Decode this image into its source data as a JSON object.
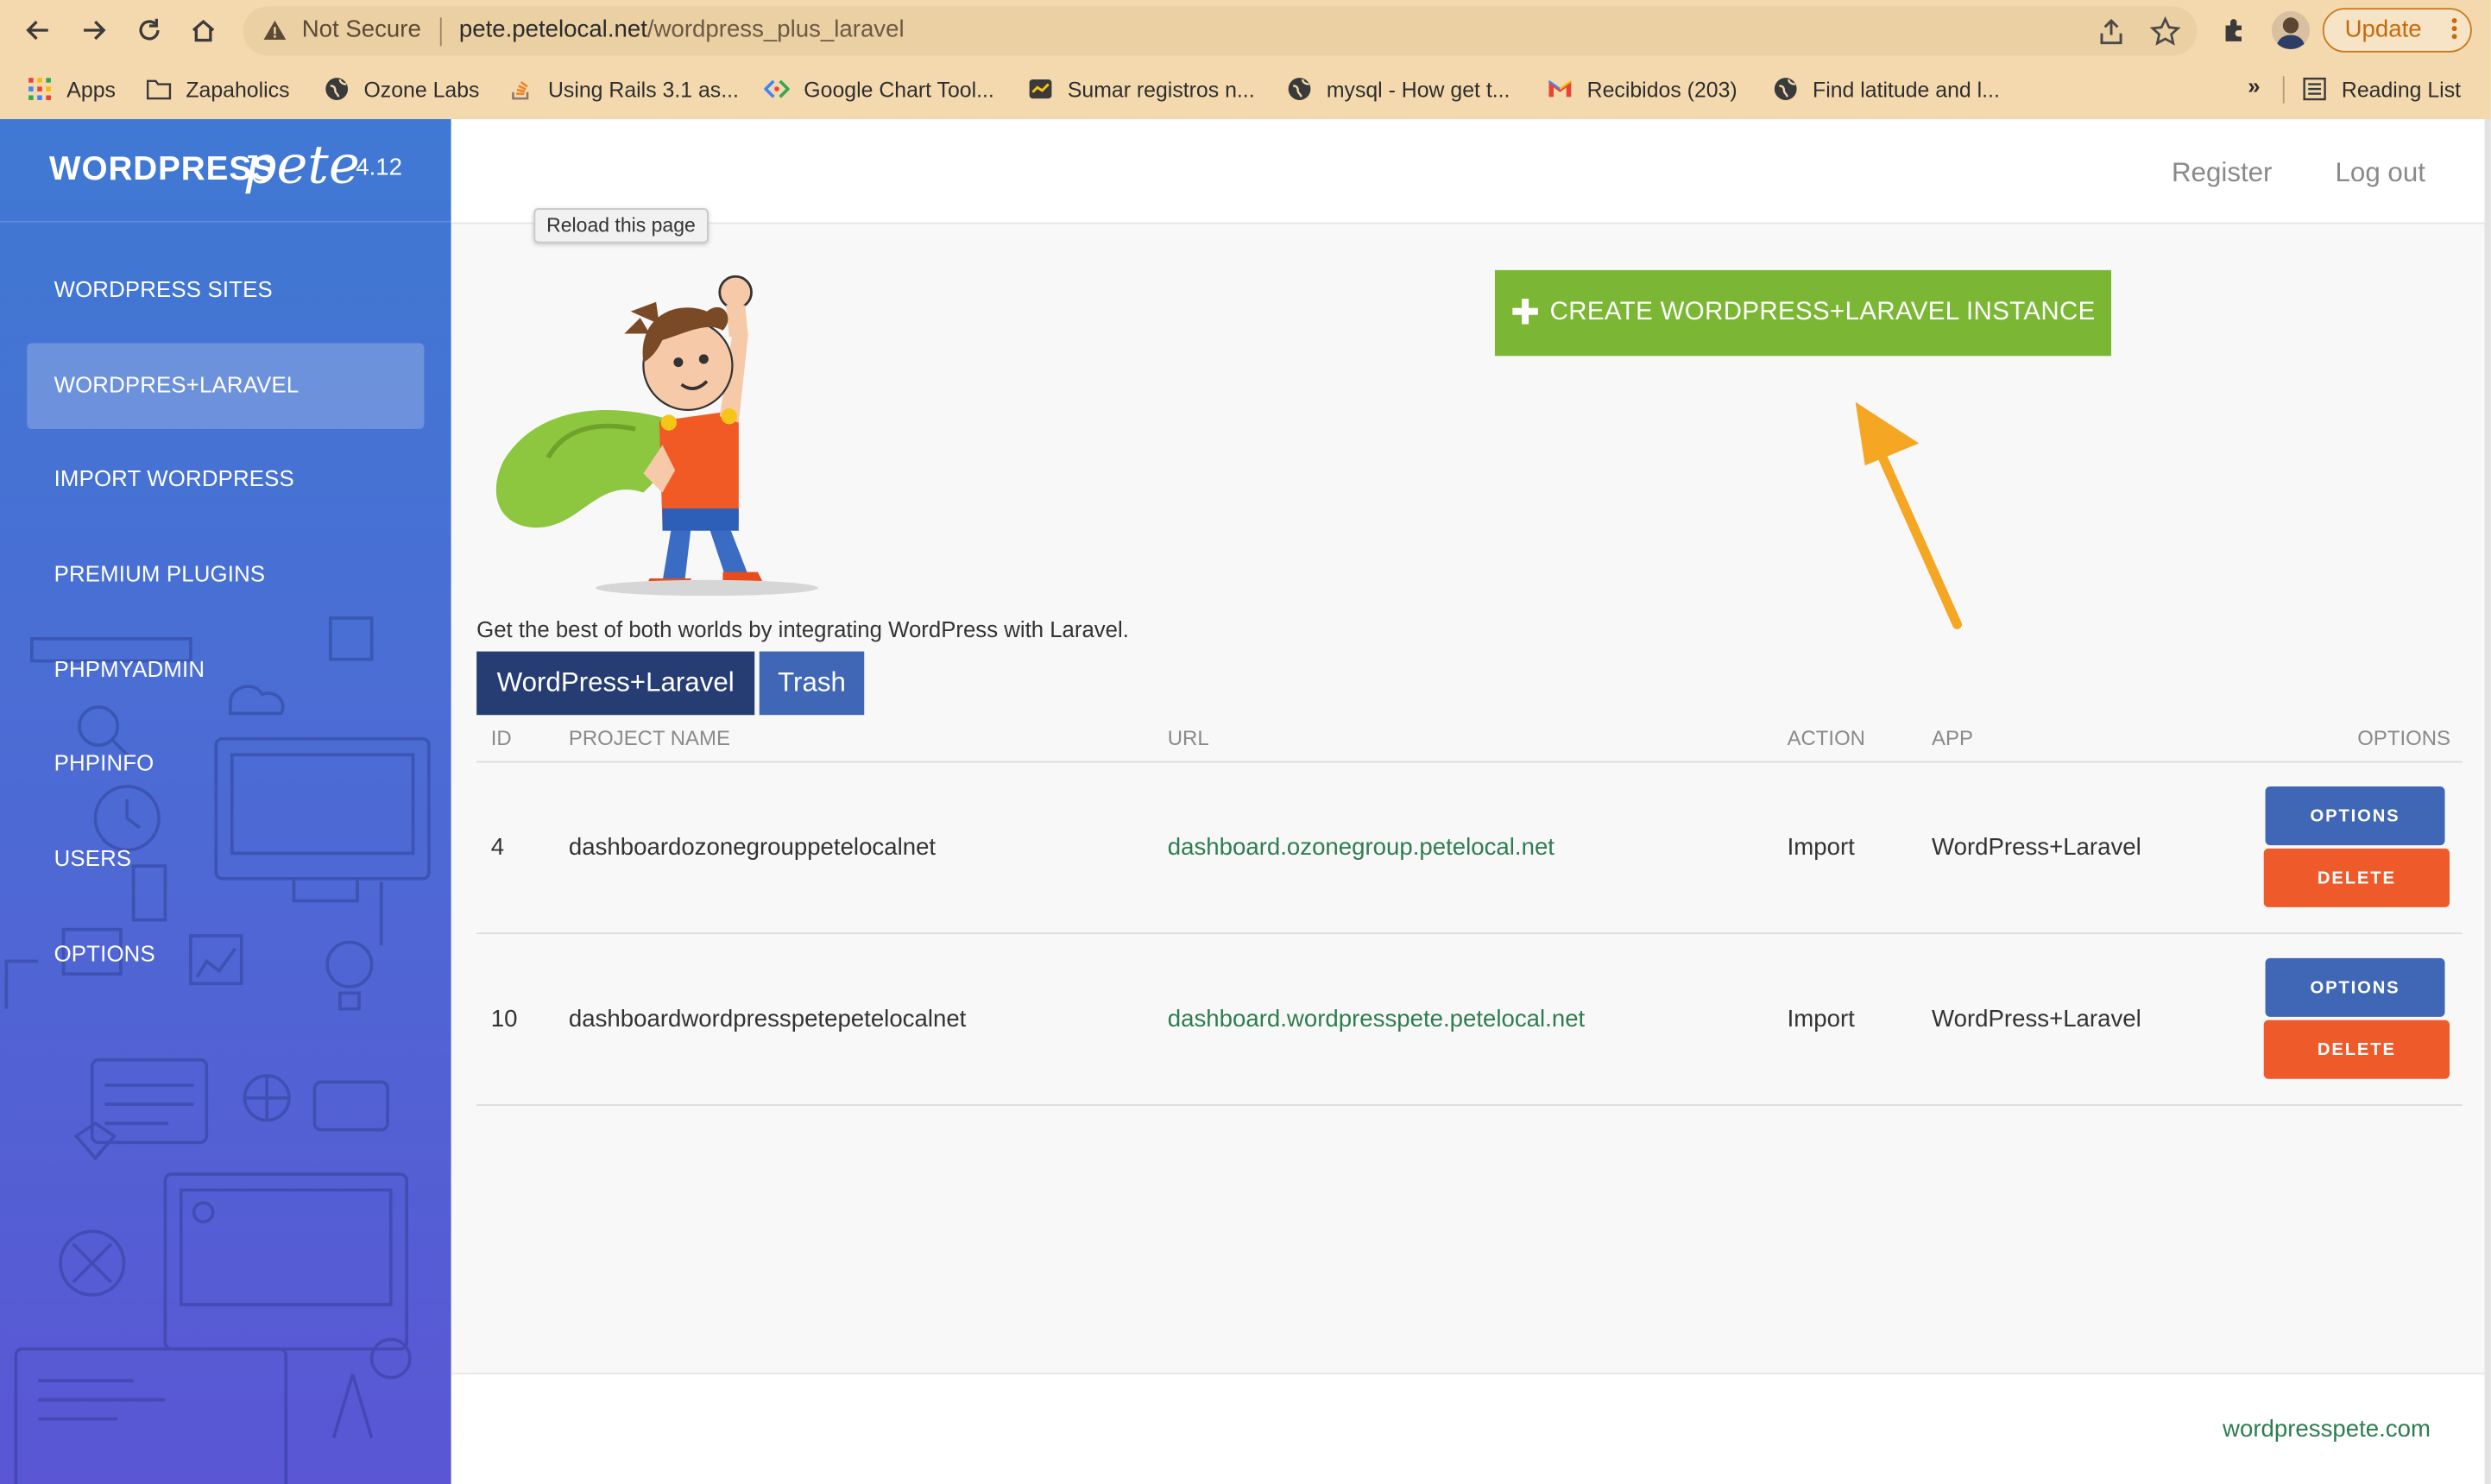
{
  "browser": {
    "security_label": "Not Secure",
    "url_host": "pete.petelocal.net",
    "url_path": "/wordpress_plus_laravel",
    "update_label": "Update",
    "bookmarks": [
      {
        "label": "Apps",
        "icon": "apps-grid-icon"
      },
      {
        "label": "Zapaholics",
        "icon": "folder-icon"
      },
      {
        "label": "Ozone Labs",
        "icon": "globe-icon"
      },
      {
        "label": "Using Rails 3.1 as...",
        "icon": "stack-overflow-icon"
      },
      {
        "label": "Google Chart Tool...",
        "icon": "code-brackets-icon"
      },
      {
        "label": "Sumar registros n...",
        "icon": "site-favicon-icon"
      },
      {
        "label": "mysql - How get t...",
        "icon": "globe-icon"
      },
      {
        "label": "Recibidos (203)",
        "icon": "gmail-icon"
      },
      {
        "label": "Find latitude and l...",
        "icon": "globe-icon"
      }
    ],
    "more_label": "»",
    "reading_list_label": "Reading List",
    "tooltip": "Reload this page"
  },
  "sidebar": {
    "brand_word": "WORDPRESS",
    "brand_script": "pete",
    "version": "4.12",
    "items": [
      {
        "label": "WORDPRESS SITES",
        "active": false
      },
      {
        "label": "WORDPRES+LARAVEL",
        "active": true
      },
      {
        "label": "IMPORT WORDPRESS",
        "active": false
      },
      {
        "label": "PREMIUM PLUGINS",
        "active": false
      },
      {
        "label": "PHPMYADMIN",
        "active": false
      },
      {
        "label": "PHPINFO",
        "active": false
      },
      {
        "label": "USERS",
        "active": false
      },
      {
        "label": "OPTIONS",
        "active": false
      }
    ]
  },
  "header": {
    "register": "Register",
    "logout": "Log out"
  },
  "main": {
    "create_button": "CREATE WORDPRESS+LARAVEL INSTANCE",
    "tagline": "Get the best of both worlds by integrating WordPress with Laravel.",
    "tabs": [
      "WordPress+Laravel",
      "Trash"
    ],
    "columns": {
      "id": "ID",
      "project": "PROJECT NAME",
      "url": "URL",
      "action": "ACTION",
      "app": "APP",
      "options": "OPTIONS"
    },
    "rows": [
      {
        "id": "4",
        "project": "dashboardozonegrouppetelocalnet",
        "url": "dashboard.ozonegroup.petelocal.net",
        "action": "Import",
        "app": "WordPress+Laravel",
        "options_label": "OPTIONS",
        "delete_label": "DELETE"
      },
      {
        "id": "10",
        "project": "dashboardwordpresspetepetelocalnet",
        "url": "dashboard.wordpresspete.petelocal.net",
        "action": "Import",
        "app": "WordPress+Laravel",
        "options_label": "OPTIONS",
        "delete_label": "DELETE"
      }
    ]
  },
  "footer": {
    "link": "wordpresspete.com"
  },
  "colors": {
    "sidebar_top": "#3f79d3",
    "sidebar_bottom": "#5a56d4",
    "create_green": "#7bb734",
    "options_blue": "#3f67b6",
    "delete_orange": "#ef5a2a",
    "link_green": "#2e7d4f",
    "arrow_orange": "#f5a623"
  }
}
